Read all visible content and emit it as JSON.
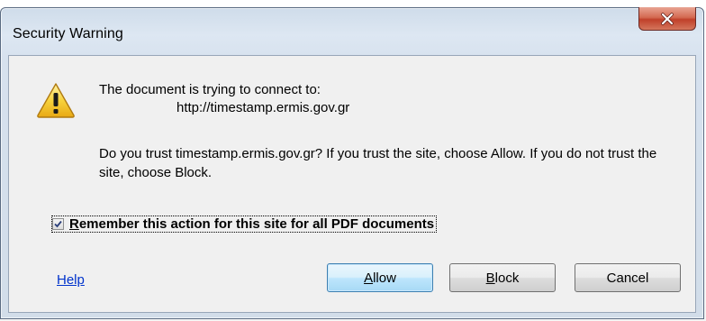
{
  "window": {
    "title": "Security Warning",
    "close_icon": "close-icon"
  },
  "message": {
    "icon": "warning-icon",
    "line1": "The document is trying to connect to:",
    "url": "http://timestamp.ermis.gov.gr",
    "question": "Do you trust timestamp.ermis.gov.gr? If you trust the site, choose Allow. If you do not trust the site, choose Block."
  },
  "remember": {
    "checked": true,
    "mnemonic": "R",
    "rest": "emember this action for this site for all PDF documents"
  },
  "help": {
    "label": "Help"
  },
  "buttons": {
    "allow": {
      "mnemonic": "A",
      "rest": "llow"
    },
    "block": {
      "mnemonic": "B",
      "rest": "lock"
    },
    "cancel": {
      "label": "Cancel"
    }
  },
  "colors": {
    "link": "#0033cc",
    "close_button": "#c0402a",
    "default_button_border": "#3c7fb1"
  }
}
